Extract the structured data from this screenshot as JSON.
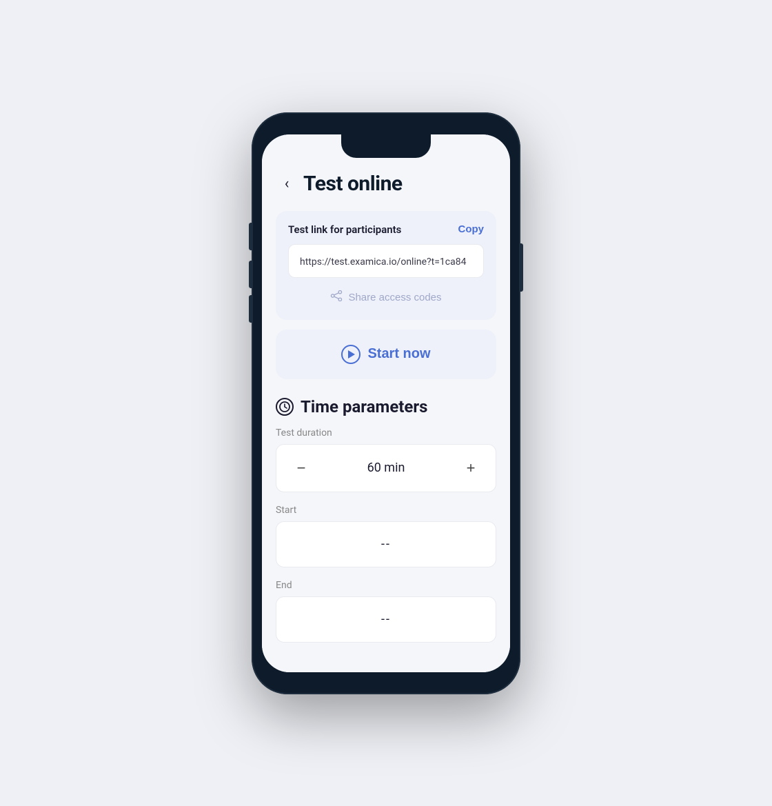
{
  "page": {
    "title": "Test online",
    "back_label": "‹"
  },
  "card": {
    "label": "Test link for participants",
    "copy_button": "Copy",
    "url": "https://test.examica.io/online?t=1ca84",
    "share_codes_label": "Share access codes"
  },
  "start_now": {
    "label": "Start now"
  },
  "time_parameters": {
    "section_title": "Time parameters",
    "duration_label": "Test duration",
    "duration_value": "60 min",
    "start_label": "Start",
    "start_value": "--",
    "end_label": "End",
    "end_value": "--"
  },
  "colors": {
    "accent": "#4a6fd4",
    "background": "#f5f6fa",
    "card_bg": "#eef1fa",
    "text_primary": "#1a1a2e",
    "text_secondary": "#888888",
    "disabled": "#a0a8c8"
  }
}
